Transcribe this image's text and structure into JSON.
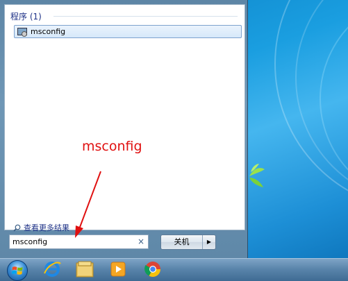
{
  "start_menu": {
    "section_header": "程序 (1)",
    "results": [
      {
        "label": "msconfig",
        "icon": "msconfig-icon"
      }
    ],
    "see_more": "查看更多结果",
    "search_value": "msconfig",
    "search_clear": "×",
    "shutdown_label": "关机"
  },
  "annotation": {
    "text": "msconfig",
    "color": "#e01010"
  },
  "taskbar": {
    "items": [
      "start-orb",
      "internet-explorer-icon",
      "file-explorer-icon",
      "media-player-icon",
      "chrome-icon"
    ]
  }
}
